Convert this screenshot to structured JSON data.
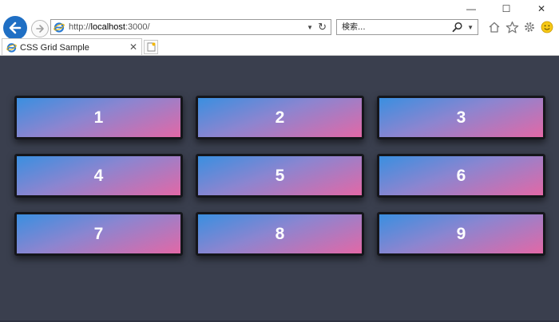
{
  "window": {
    "minimize_glyph": "—",
    "maximize_glyph": "☐",
    "close_glyph": "✕"
  },
  "address": {
    "prefix": "http://",
    "host": "localhost",
    "port": ":3000/"
  },
  "search": {
    "placeholder": "検索..."
  },
  "tab": {
    "title": "CSS Grid Sample",
    "close_glyph": "✕"
  },
  "icons": {
    "back": "back-arrow-icon",
    "forward": "forward-arrow-icon",
    "site": "ie-logo-icon",
    "refresh": "refresh-icon",
    "search": "magnifier-icon",
    "home": "home-icon",
    "favorites": "star-icon",
    "tools": "gear-icon",
    "feedback": "smiley-icon",
    "new_tab": "new-tab-icon"
  },
  "colors": {
    "page_background": "#3a3f4e",
    "cell_border": "#15161b",
    "gradient_start": "#3a8fe0",
    "gradient_end": "#e268a6",
    "back_button": "#1f6fc4"
  },
  "grid": {
    "items": [
      "1",
      "2",
      "3",
      "4",
      "5",
      "6",
      "7",
      "8",
      "9"
    ]
  }
}
